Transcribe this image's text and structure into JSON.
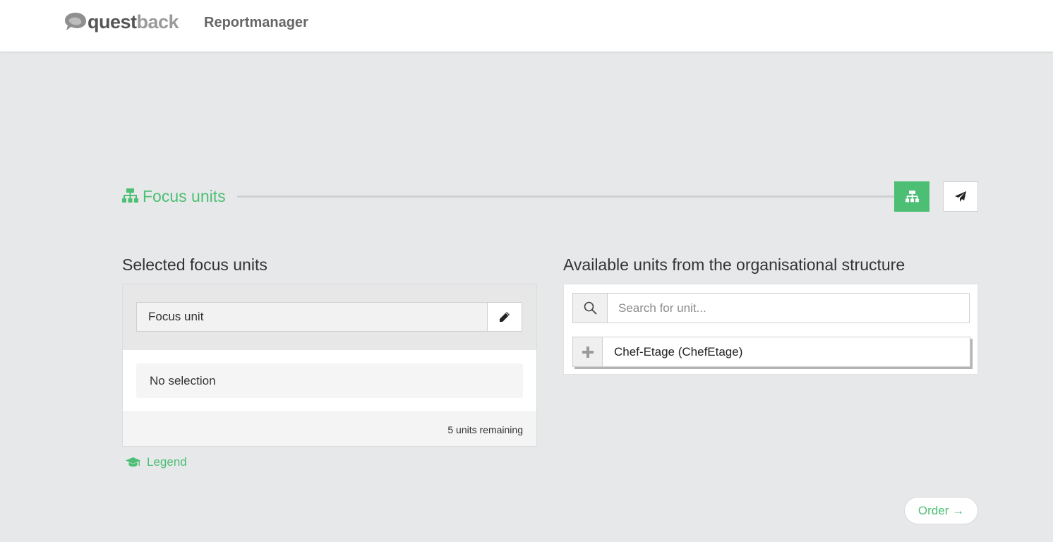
{
  "header": {
    "logo_text_part1": "quest",
    "logo_text_part2": "back",
    "app_title": "Reportmanager"
  },
  "wizard": {
    "section_title": "Focus units",
    "steps": [
      {
        "icon": "sitemap-icon",
        "active": true
      },
      {
        "icon": "paper-plane-icon",
        "active": false
      }
    ]
  },
  "selected": {
    "heading": "Selected focus units",
    "field_value": "Focus unit",
    "empty_text": "No selection",
    "remaining_text": "5 units remaining"
  },
  "legend_label": "Legend",
  "available": {
    "heading": "Available units from the organisational structure",
    "search_placeholder": "Search for unit...",
    "units": [
      {
        "label": "Chef-Etage (ChefEtage)"
      }
    ]
  },
  "order_button": "Order →",
  "colors": {
    "accent": "#4cbf74",
    "background": "#e7e8ea"
  }
}
